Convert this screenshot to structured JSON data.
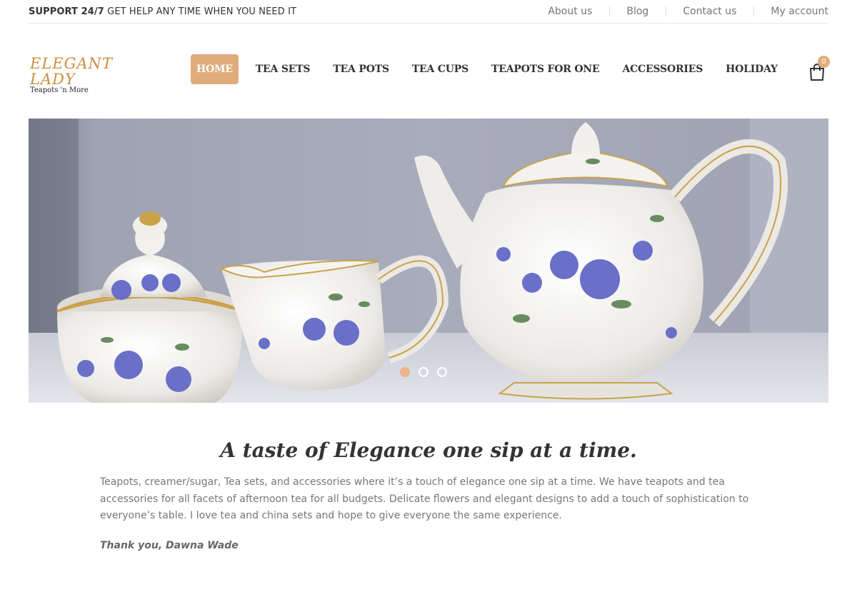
{
  "topbar": {
    "support_bold": "SUPPORT 24/7",
    "support_text": "GET HELP ANY TIME WHEN YOU NEED IT",
    "links": [
      "About us",
      "Blog",
      "Contact us",
      "My account"
    ]
  },
  "logo": {
    "title": "ELEGANT LADY",
    "subtitle": "Teapots 'n More"
  },
  "nav": {
    "items": [
      "HOME",
      "TEA SETS",
      "TEA POTS",
      "TEA CUPS",
      "TEAPOTS FOR ONE",
      "ACCESSORIES",
      "HOLIDAY"
    ],
    "active": "HOME"
  },
  "cart": {
    "count": "0",
    "icon": "shopping-bag-icon"
  },
  "hero": {
    "description": "",
    "slides": 3,
    "active_slide": 1
  },
  "content": {
    "headline": "A taste of Elegance one sip at a time.",
    "paragraph": "Teapots, creamer/sugar, Tea sets, and accessories where it’s a touch of elegance one sip at a time. We have teapots and tea accessories for all facets of afternoon tea for all budgets. Delicate flowers and elegant designs to add a touch of sophistication to everyone’s table. I love tea and china sets and hope to give everyone the same experience.",
    "signature": "Thank you, Dawna Wade"
  },
  "colors": {
    "accent": "#e0ac7b",
    "rose": "#6a6fc8",
    "leaf": "#4f7a45"
  }
}
